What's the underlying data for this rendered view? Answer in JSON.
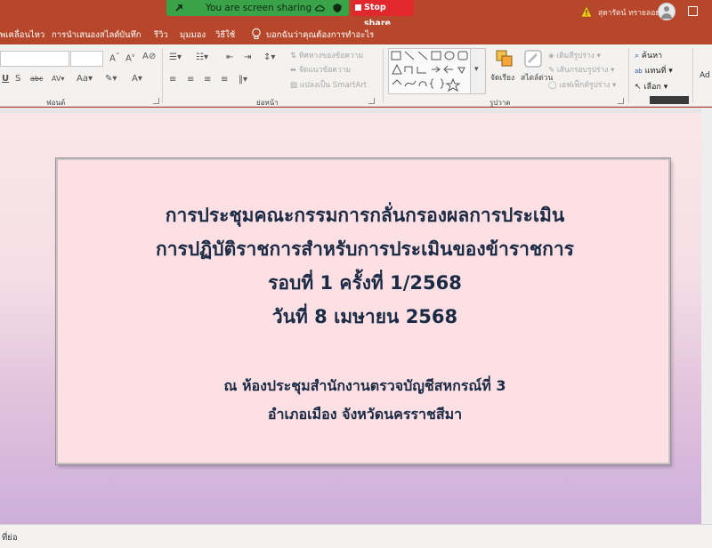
{
  "titlebar": {
    "sharing_label": "You are screen sharing",
    "stop_share_label": "Stop share",
    "user_name": "สุดารัตน์ ทรายลอยน"
  },
  "tabs": [
    "พเคลื่อนไหว",
    "การนำเสนองสไลด์",
    "บันทึก",
    "รีวิว",
    "มุมมอง",
    "วิธีใช้",
    "บอกฉันว่าคุณต้องการทำอะไร"
  ],
  "ribbon": {
    "groups": {
      "font": "ฟอนต์",
      "paragraph": "ย่อหน้า",
      "drawing": "รูปวาด"
    },
    "paragraph_cmds": {
      "text_direction": "ทิศทางของข้อความ",
      "align_text": "จัดแนวข้อความ",
      "convert_smartart": "แปลงเป็น SmartArt"
    },
    "drawing_cmds": {
      "arrange": "จัดเรียง",
      "quick_styles": "สไตล์ด่วน",
      "shape_fill": "เติมสีรูปร่าง",
      "shape_outline": "เส้นกรอบรูปร่าง",
      "shape_effects": "เอฟเฟ็กต์รูปร่าง"
    },
    "editing_cmds": {
      "find": "ค้นหา",
      "replace": "แทนที่",
      "select": "เลือก"
    },
    "addins_partial": "Ad"
  },
  "slide": {
    "title_lines": [
      "การประชุมคณะกรรมการกลั่นกรองผลการประเมิน",
      "การปฏิบัติราชการสำหรับการประเมินของข้าราชการ",
      "รอบที่ 1  ครั้งที่ 1/2568",
      "วันที่ 8  เมษายน  2568"
    ],
    "location_lines": [
      "ณ  ห้องประชุมสำนักงานตรวจบัญชีสหกรณ์ที่ 3",
      "อำเภอเมือง จังหวัดนครราชสีมา"
    ]
  },
  "status": {
    "notes_label": "ที่ย่อ"
  },
  "colors": {
    "accent": "#b7472a",
    "share_green": "#3aa34a",
    "stop_red": "#e0282d",
    "slide_text": "#1b2a45",
    "box_fill": "#fde0e3"
  }
}
